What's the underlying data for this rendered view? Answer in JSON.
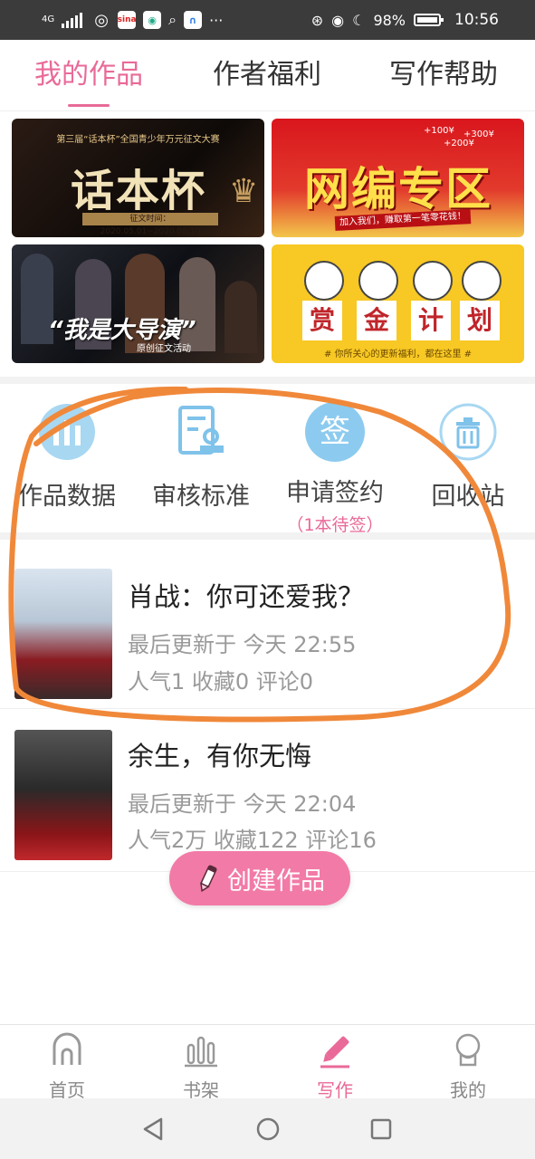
{
  "status_bar": {
    "network": "4G",
    "battery": "98%",
    "time": "10:56",
    "more": "···",
    "app1": "sina"
  },
  "tabs": [
    {
      "label": "我的作品",
      "active": true
    },
    {
      "label": "作者福利",
      "active": false
    },
    {
      "label": "写作帮助",
      "active": false
    }
  ],
  "banners": {
    "b1": {
      "top": "第三届“话本杯”全国青少年万元征文大赛",
      "main": "话本杯",
      "date": "征文时间：2020.05.01~2020.08.10"
    },
    "b2": {
      "main": "网编专区",
      "sub": "加入我们，赚取第一笔零花钱！",
      "p1": "+100¥",
      "p2": "+300¥",
      "p3": "+200¥"
    },
    "b3": {
      "main": "“我是大导演”",
      "sub": "原创征文活动"
    },
    "b4": {
      "chars": [
        "赏",
        "金",
        "计",
        "划"
      ],
      "sub": "# 你所关心的更新福利，都在这里 #"
    }
  },
  "quick_actions": [
    {
      "label": "作品数据",
      "sub": ""
    },
    {
      "label": "审核标准",
      "sub": ""
    },
    {
      "label": "申请签约",
      "sub": "（1本待签）",
      "icon_text": "签"
    },
    {
      "label": "回收站",
      "sub": ""
    }
  ],
  "works": [
    {
      "title": "肖战：你可还爱我？",
      "updated": "最后更新于 今天 22:55",
      "stats": "人气1 收藏0 评论0"
    },
    {
      "title": "余生，有你无悔",
      "updated": "最后更新于 今天 22:04",
      "stats": "人气2万 收藏122 评论16"
    }
  ],
  "create_button": {
    "label": "创建作品"
  },
  "bottom_nav": [
    {
      "label": "首页",
      "active": false
    },
    {
      "label": "书架",
      "active": false
    },
    {
      "label": "写作",
      "active": true
    },
    {
      "label": "我的",
      "active": false
    }
  ],
  "colors": {
    "accent": "#e96a98",
    "button": "#f27aa6",
    "icon_blue": "#7fc2ea",
    "annotation": "#f0883a"
  }
}
